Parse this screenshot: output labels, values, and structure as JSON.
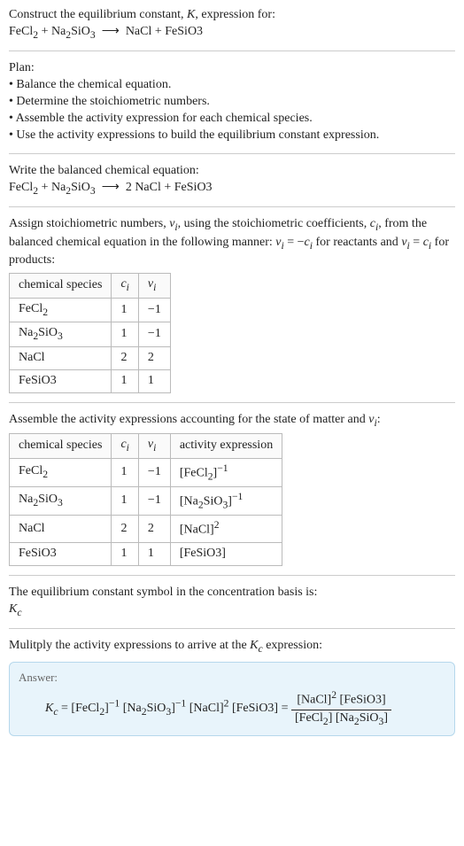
{
  "intro": {
    "line1_a": "Construct the equilibrium constant, ",
    "line1_b": ", expression for:",
    "K": "K",
    "eq_unbalanced_html": "FeCl<sub>2</sub> + Na<sub>2</sub>SiO<sub>3</sub> &nbsp;⟶&nbsp; NaCl + FeSiO3"
  },
  "plan": {
    "heading": "Plan:",
    "b1": "• Balance the chemical equation.",
    "b2": "• Determine the stoichiometric numbers.",
    "b3": "• Assemble the activity expression for each chemical species.",
    "b4": "• Use the activity expressions to build the equilibrium constant expression."
  },
  "balanced": {
    "heading": "Write the balanced chemical equation:",
    "eq_html": "FeCl<sub>2</sub> + Na<sub>2</sub>SiO<sub>3</sub> &nbsp;⟶&nbsp; 2 NaCl + FeSiO3"
  },
  "assign": {
    "text_html": "Assign stoichiometric numbers, <span class='italic'>ν<sub>i</sub></span>, using the stoichiometric coefficients, <span class='italic'>c<sub>i</sub></span>, from the balanced chemical equation in the following manner: <span class='italic'>ν<sub>i</sub></span> = −<span class='italic'>c<sub>i</sub></span> for reactants and <span class='italic'>ν<sub>i</sub></span> = <span class='italic'>c<sub>i</sub></span> for products:"
  },
  "table1": {
    "h1": "chemical species",
    "h2_html": "<span class='italic'>c<sub>i</sub></span>",
    "h3_html": "<span class='italic'>ν<sub>i</sub></span>",
    "rows": [
      {
        "sp_html": "FeCl<sub>2</sub>",
        "c": "1",
        "v": "−1"
      },
      {
        "sp_html": "Na<sub>2</sub>SiO<sub>3</sub>",
        "c": "1",
        "v": "−1"
      },
      {
        "sp_html": "NaCl",
        "c": "2",
        "v": "2"
      },
      {
        "sp_html": "FeSiO3",
        "c": "1",
        "v": "1"
      }
    ]
  },
  "assemble_text_html": "Assemble the activity expressions accounting for the state of matter and <span class='italic'>ν<sub>i</sub></span>:",
  "table2": {
    "h1": "chemical species",
    "h2_html": "<span class='italic'>c<sub>i</sub></span>",
    "h3_html": "<span class='italic'>ν<sub>i</sub></span>",
    "h4": "activity expression",
    "rows": [
      {
        "sp_html": "FeCl<sub>2</sub>",
        "c": "1",
        "v": "−1",
        "act_html": "[FeCl<sub>2</sub>]<sup>−1</sup>"
      },
      {
        "sp_html": "Na<sub>2</sub>SiO<sub>3</sub>",
        "c": "1",
        "v": "−1",
        "act_html": "[Na<sub>2</sub>SiO<sub>3</sub>]<sup>−1</sup>"
      },
      {
        "sp_html": "NaCl",
        "c": "2",
        "v": "2",
        "act_html": "[NaCl]<sup>2</sup>"
      },
      {
        "sp_html": "FeSiO3",
        "c": "1",
        "v": "1",
        "act_html": "[FeSiO3]"
      }
    ]
  },
  "kc_basis": {
    "line1": "The equilibrium constant symbol in the concentration basis is:",
    "kc_html": "<span class='italic'>K<sub>c</sub></span>"
  },
  "multiply_text_html": "Mulitply the activity expressions to arrive at the <span class='italic'>K<sub>c</sub></span> expression:",
  "answer": {
    "label": "Answer:",
    "lhs_html": "<span class='italic'>K<sub>c</sub></span> = [FeCl<sub>2</sub>]<sup>−1</sup> [Na<sub>2</sub>SiO<sub>3</sub>]<sup>−1</sup> [NaCl]<sup>2</sup> [FeSiO3] = ",
    "num_html": "[NaCl]<sup>2</sup> [FeSiO3]",
    "den_html": "[FeCl<sub>2</sub>] [Na<sub>2</sub>SiO<sub>3</sub>]"
  }
}
